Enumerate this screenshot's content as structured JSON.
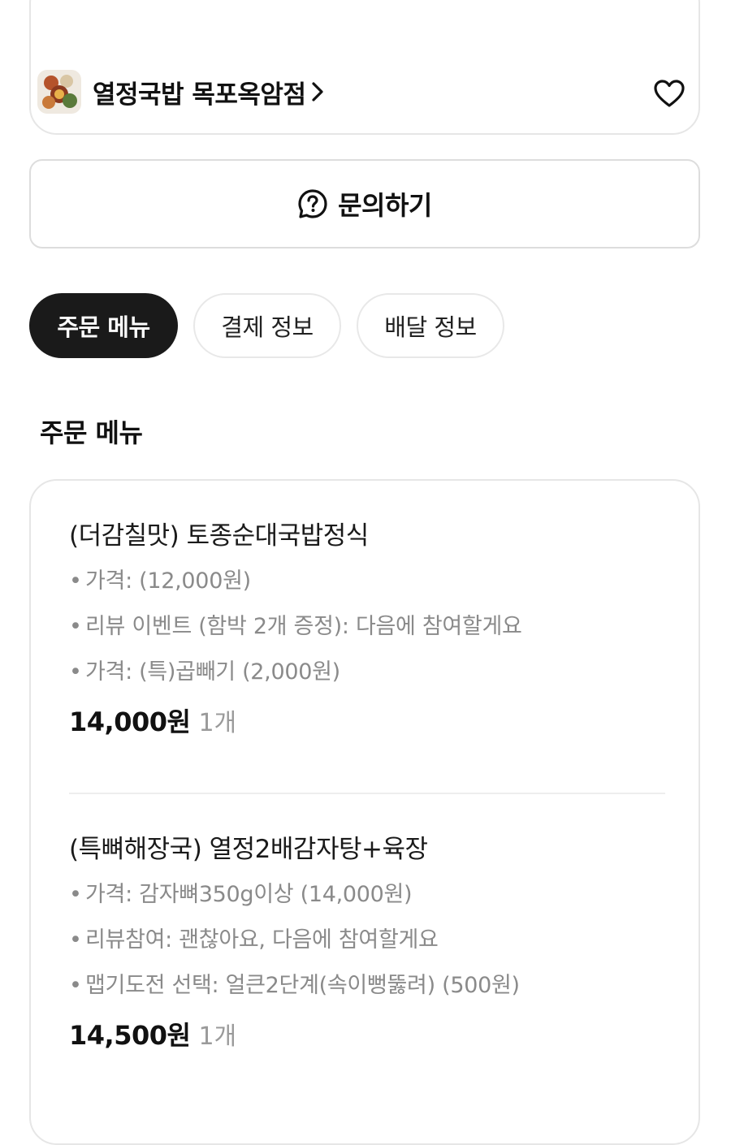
{
  "store": {
    "name": "열정국밥 목포옥암점"
  },
  "inquiry": {
    "label": "문의하기"
  },
  "tabs": [
    {
      "label": "주문 메뉴",
      "active": true
    },
    {
      "label": "결제 정보",
      "active": false
    },
    {
      "label": "배달 정보",
      "active": false
    }
  ],
  "section": {
    "title": "주문 메뉴"
  },
  "order_items": [
    {
      "name": "(더감칠맛) 토종순대국밥정식",
      "options": [
        "가격:  (12,000원)",
        "리뷰 이벤트 (함박 2개 증정): 다음에 참여할게요",
        "가격: (특)곱빼기 (2,000원)"
      ],
      "price": "14,000원",
      "quantity": "1개"
    },
    {
      "name": "(특뼈해장국) 열정2배감자탕+육장",
      "options": [
        "가격: 감자뼈350g이상 (14,000원)",
        "리뷰참여: 괜찮아요, 다음에 참여할게요",
        "맵기도전 선택: 얼큰2단계(속이뻥뚫려) (500원)"
      ],
      "price": "14,500원",
      "quantity": "1개"
    }
  ],
  "colors": {
    "active_tab_bg": "#1a1a1a",
    "border": "#e6e6e6",
    "option_text": "#8a8a8a"
  },
  "icons": {
    "store_thumbnail": "food-platter-thumbnail",
    "chevron": "chevron-right-icon",
    "favorite": "heart-icon",
    "inquiry": "question-bubble-icon"
  }
}
